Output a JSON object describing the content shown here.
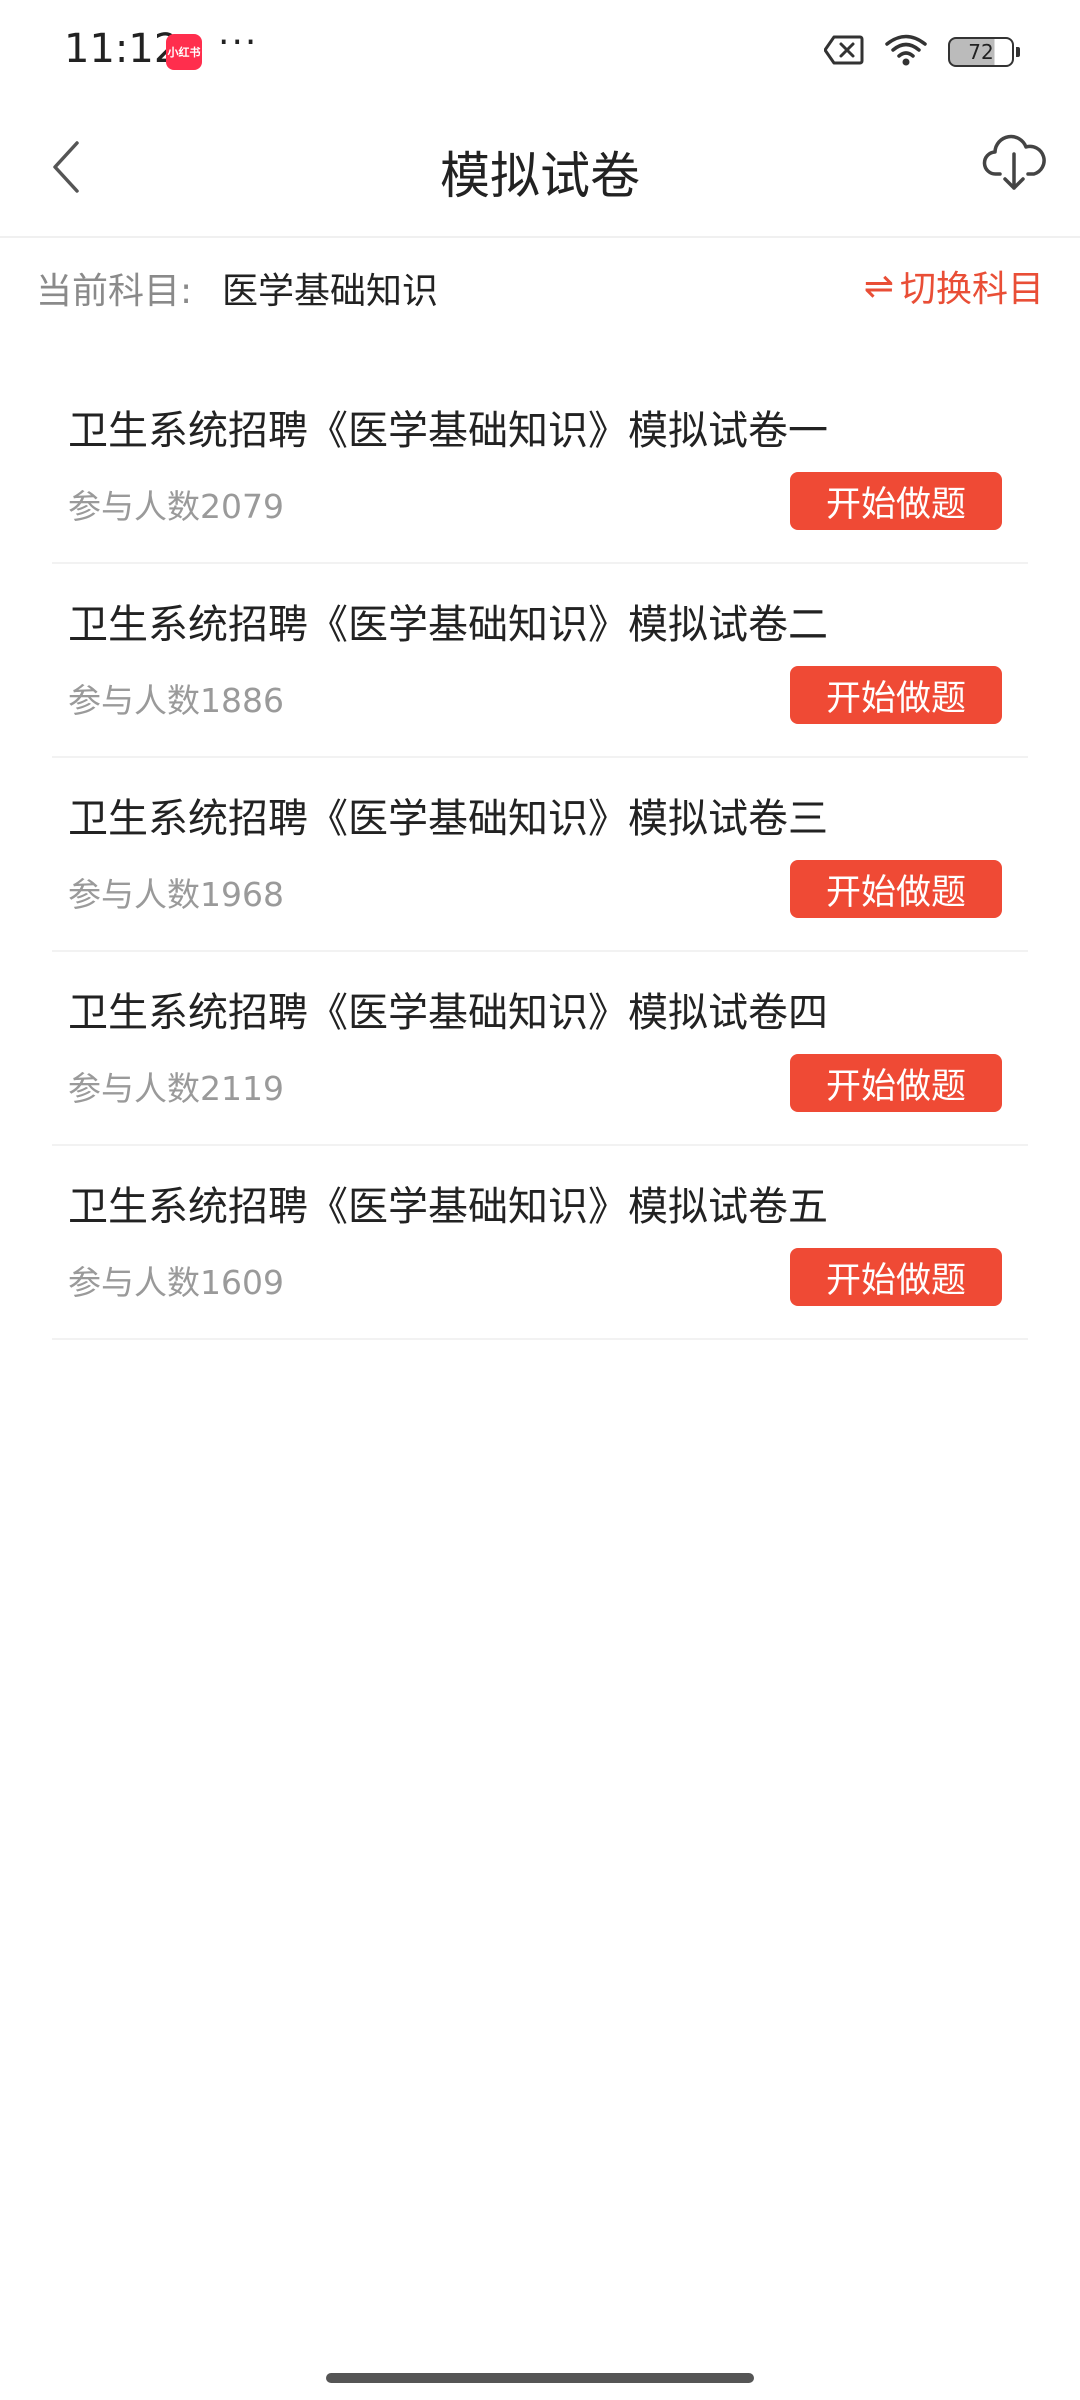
{
  "status_bar": {
    "time": "11:12",
    "app_badge": "小红书",
    "more": "···",
    "battery": "72"
  },
  "nav": {
    "title": "模拟试卷"
  },
  "subject": {
    "label": "当前科目:",
    "value": "医学基础知识",
    "switch_icon": "⇌",
    "switch_label": "切换科目"
  },
  "papers": [
    {
      "title": "卫生系统招聘《医学基础知识》模拟试卷一",
      "participants": "参与人数2079",
      "button": "开始做题"
    },
    {
      "title": "卫生系统招聘《医学基础知识》模拟试卷二",
      "participants": "参与人数1886",
      "button": "开始做题"
    },
    {
      "title": "卫生系统招聘《医学基础知识》模拟试卷三",
      "participants": "参与人数1968",
      "button": "开始做题"
    },
    {
      "title": "卫生系统招聘《医学基础知识》模拟试卷四",
      "participants": "参与人数2119",
      "button": "开始做题"
    },
    {
      "title": "卫生系统招聘《医学基础知识》模拟试卷五",
      "participants": "参与人数1609",
      "button": "开始做题"
    }
  ],
  "colors": {
    "accent": "#ef4a35",
    "text_primary": "#222222",
    "text_secondary": "#9a9a9a"
  }
}
